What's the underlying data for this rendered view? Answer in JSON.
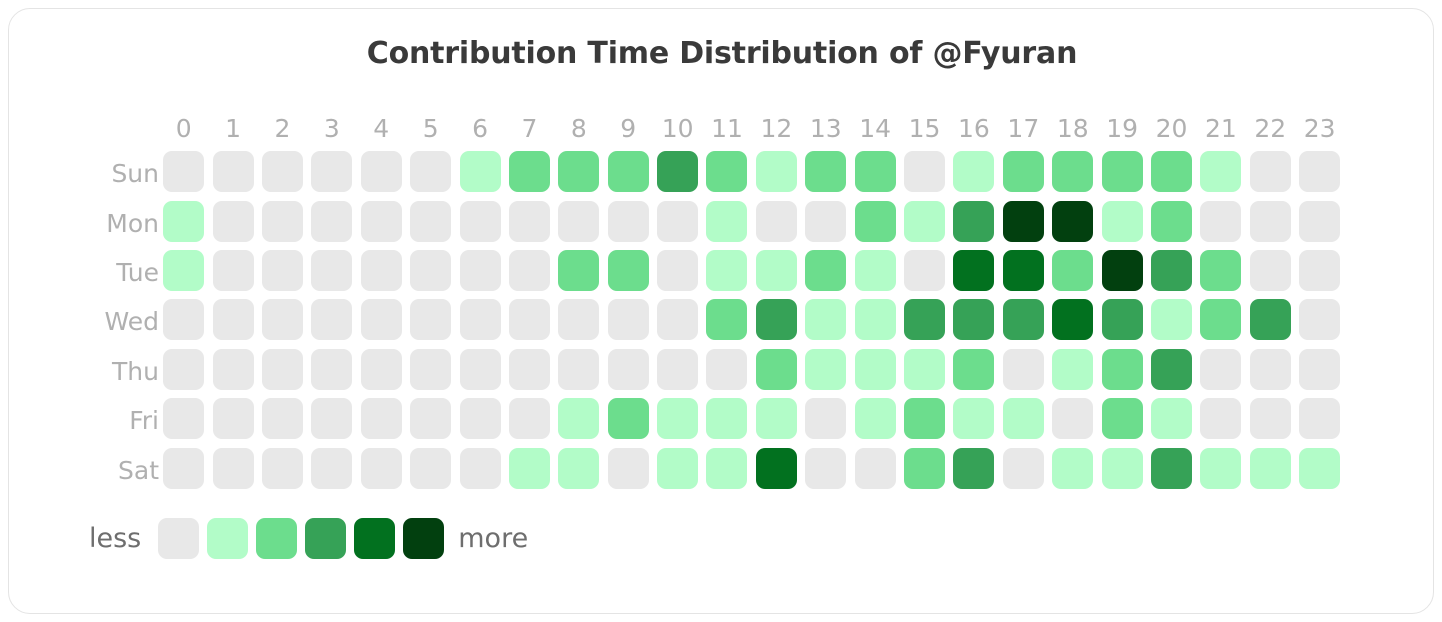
{
  "chart_data": {
    "type": "heatmap",
    "title": "Contribution Time Distribution of @Fyuran",
    "xlabel": "",
    "ylabel": "",
    "x_tick_labels": [
      "0",
      "1",
      "2",
      "3",
      "4",
      "5",
      "6",
      "7",
      "8",
      "9",
      "10",
      "11",
      "12",
      "13",
      "14",
      "15",
      "16",
      "17",
      "18",
      "19",
      "20",
      "21",
      "22",
      "23"
    ],
    "y_tick_labels": [
      "Sun",
      "Mon",
      "Tue",
      "Wed",
      "Thu",
      "Fri",
      "Sat"
    ],
    "grid": false,
    "legend_position": "bottom-left",
    "legend_low_label": "less",
    "legend_high_label": "more",
    "level_colors": [
      "#e8e8e8",
      "#b2fcc8",
      "#6cdd8d",
      "#36a257",
      "#02711f",
      "#02400f"
    ],
    "levels": 6,
    "value_min": 0,
    "value_max": 5,
    "rows": [
      {
        "day": "Sun",
        "values": [
          0,
          0,
          0,
          0,
          0,
          0,
          1,
          2,
          2,
          2,
          3,
          2,
          1,
          2,
          2,
          0,
          1,
          2,
          2,
          2,
          2,
          1,
          0,
          0
        ]
      },
      {
        "day": "Mon",
        "values": [
          1,
          0,
          0,
          0,
          0,
          0,
          0,
          0,
          0,
          0,
          0,
          1,
          0,
          0,
          2,
          1,
          3,
          5,
          5,
          1,
          2,
          0,
          0,
          0
        ]
      },
      {
        "day": "Tue",
        "values": [
          1,
          0,
          0,
          0,
          0,
          0,
          0,
          0,
          2,
          2,
          0,
          1,
          1,
          2,
          1,
          0,
          4,
          4,
          2,
          5,
          3,
          2,
          0,
          0
        ]
      },
      {
        "day": "Wed",
        "values": [
          0,
          0,
          0,
          0,
          0,
          0,
          0,
          0,
          0,
          0,
          0,
          2,
          3,
          1,
          1,
          3,
          3,
          3,
          4,
          3,
          1,
          2,
          3,
          0
        ]
      },
      {
        "day": "Thu",
        "values": [
          0,
          0,
          0,
          0,
          0,
          0,
          0,
          0,
          0,
          0,
          0,
          0,
          2,
          1,
          1,
          1,
          2,
          0,
          1,
          2,
          3,
          0,
          0,
          0
        ]
      },
      {
        "day": "Fri",
        "values": [
          0,
          0,
          0,
          0,
          0,
          0,
          0,
          0,
          1,
          2,
          1,
          1,
          1,
          0,
          1,
          2,
          1,
          1,
          0,
          2,
          1,
          0,
          0,
          0
        ]
      },
      {
        "day": "Sat",
        "values": [
          0,
          0,
          0,
          0,
          0,
          0,
          0,
          1,
          1,
          0,
          1,
          1,
          4,
          0,
          0,
          2,
          3,
          0,
          1,
          1,
          3,
          1,
          1,
          1
        ]
      }
    ]
  }
}
